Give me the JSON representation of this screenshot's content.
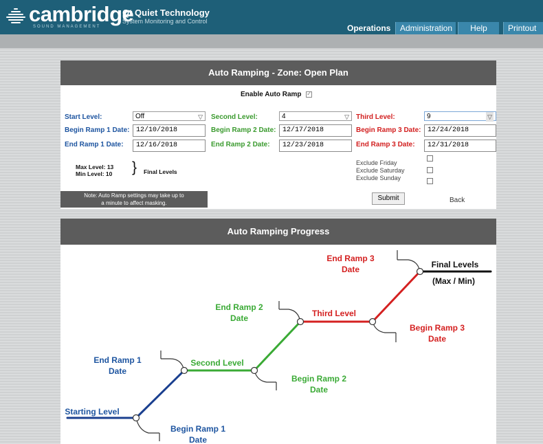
{
  "header": {
    "brand": "cambridge",
    "brand_sub": "SOUND MANAGEMENT",
    "product": "Qt Quiet Technology",
    "product_sub": "System Monitoring and Control",
    "nav": [
      "Operations",
      "Administration",
      "Help",
      "Printout"
    ],
    "active_nav": "Operations",
    "colors": {
      "topbar": "#1e5f78",
      "tab": "#3a87ab"
    }
  },
  "settings": {
    "title": "Auto Ramping - Zone: Open Plan",
    "enable_label": "Enable Auto Ramp",
    "enable_checked": true,
    "start_level_label": "Start Level:",
    "start_level": "Off",
    "second_level_label": "Second Level:",
    "second_level": "4",
    "third_level_label": "Third Level:",
    "third_level": "9",
    "begin1_label": "Begin Ramp 1 Date:",
    "begin1": "12/10/2018",
    "begin2_label": "Begin Ramp 2 Date:",
    "begin2": "12/17/2018",
    "begin3_label": "Begin Ramp 3 Date:",
    "begin3": "12/24/2018",
    "end1_label": "End Ramp 1 Date:",
    "end1": "12/16/2018",
    "end2_label": "End Ramp 2 Date:",
    "end2": "12/23/2018",
    "end3_label": "End Ramp 3 Date:",
    "end3": "12/31/2018",
    "max_level": "Max Level: 13",
    "min_level": "Min Level: 10",
    "brace": "}",
    "final_levels": "Final Levels",
    "exclude_friday": "Exclude Friday",
    "exclude_saturday": "Exclude Saturday",
    "exclude_sunday": "Exclude Sunday",
    "note_line1": "Note: Auto Ramp settings may take up to",
    "note_line2": "a minute to affect masking.",
    "submit": "Submit",
    "back": "Back",
    "colors": {
      "ramp1": "#1e55a0",
      "ramp2": "#3a9a2e",
      "ramp3": "#d21e1e"
    }
  },
  "progress": {
    "title": "Auto Ramping Progress",
    "end_ramp_3": [
      "End Ramp 3",
      "Date"
    ],
    "final_levels": "Final Levels",
    "max_min": "(Max / Min)",
    "end_ramp_2": [
      "End Ramp 2",
      "Date"
    ],
    "third_level": "Third Level",
    "begin_ramp_3": [
      "Begin Ramp 3",
      "Date"
    ],
    "end_ramp_1": [
      "End Ramp 1",
      "Date"
    ],
    "second_level": "Second Level",
    "begin_ramp_2": [
      "Begin Ramp 2",
      "Date"
    ],
    "starting_level": "Starting Level",
    "begin_ramp_1": [
      "Begin Ramp 1",
      "Date"
    ]
  }
}
